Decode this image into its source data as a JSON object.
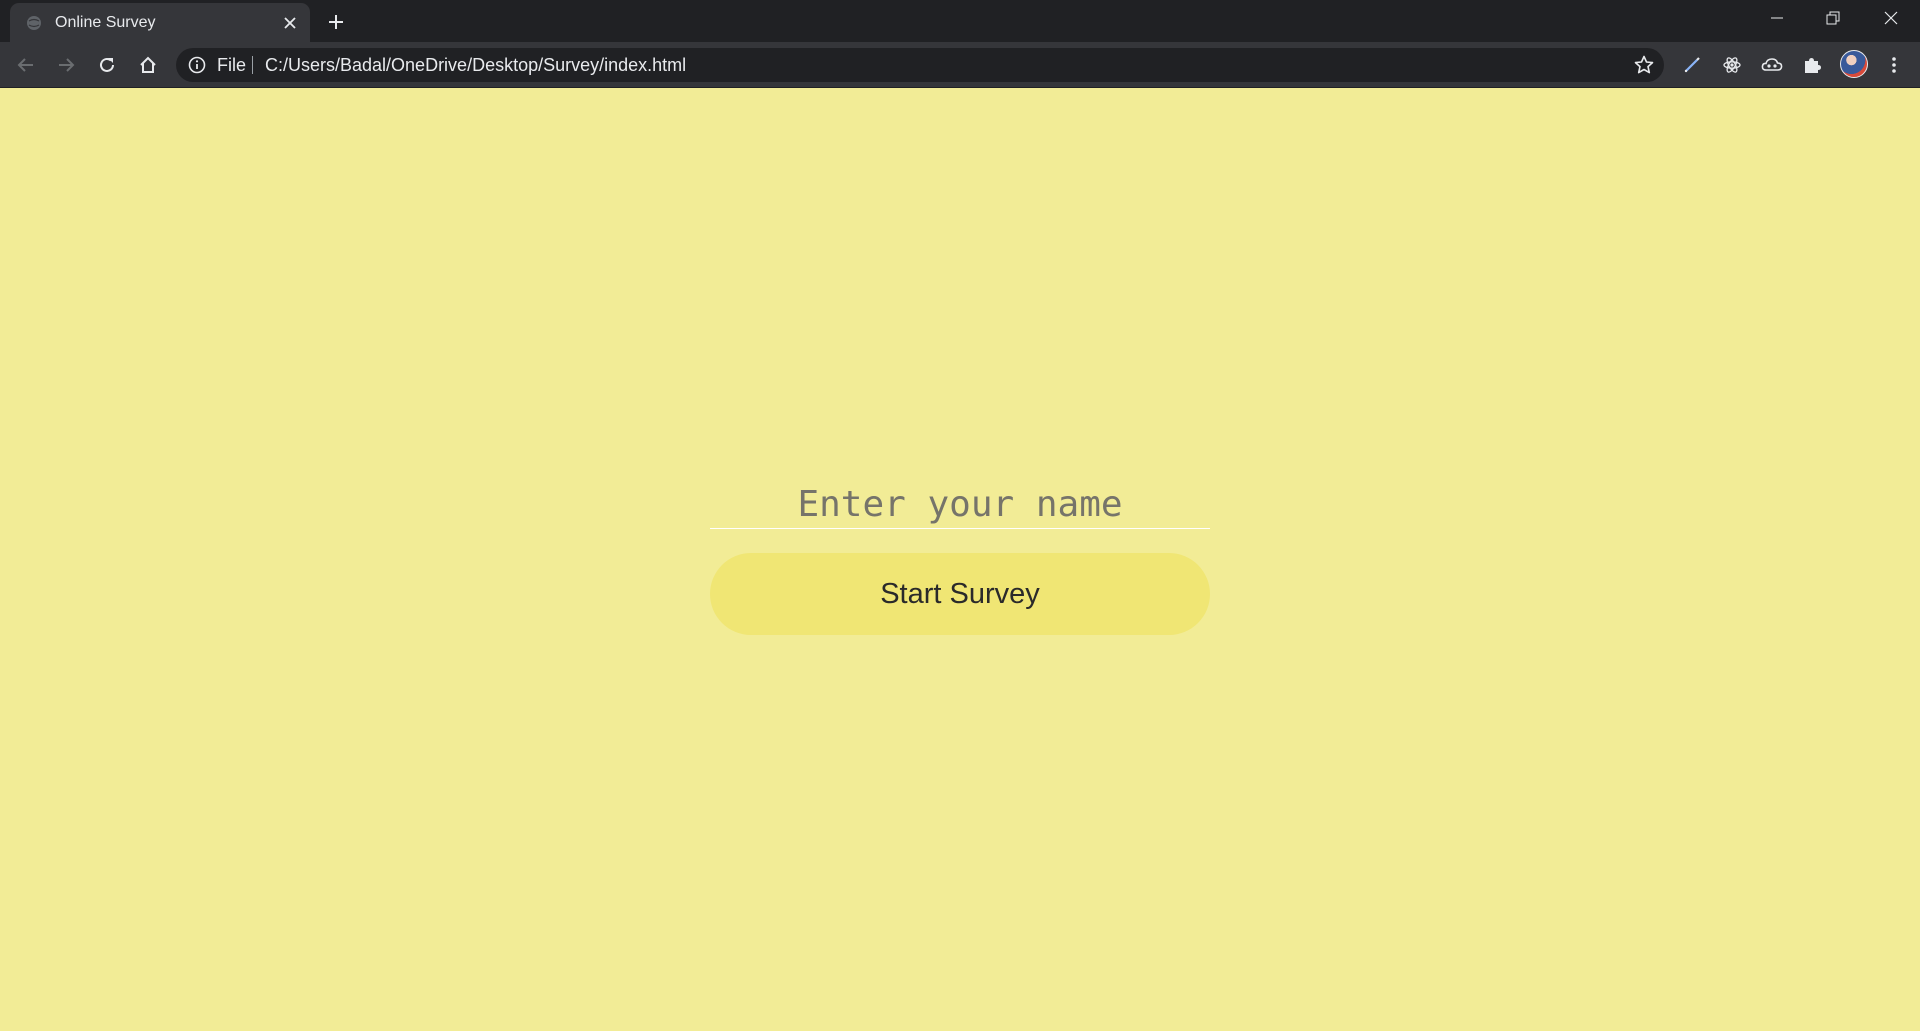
{
  "window": {
    "tab_title": "Online Survey",
    "minimize_icon": "minimize-icon",
    "restore_icon": "restore-icon",
    "close_icon": "close-icon"
  },
  "toolbar": {
    "scheme_label": "File",
    "url": "C:/Users/Badal/OneDrive/Desktop/Survey/index.html"
  },
  "form": {
    "name_placeholder": "Enter your name",
    "name_value": "",
    "start_button_label": "Start Survey"
  },
  "colors": {
    "page_background": "#f2ec96",
    "button_background": "#f0e674",
    "chrome_dark": "#202124",
    "chrome_toolbar": "#35363a"
  }
}
